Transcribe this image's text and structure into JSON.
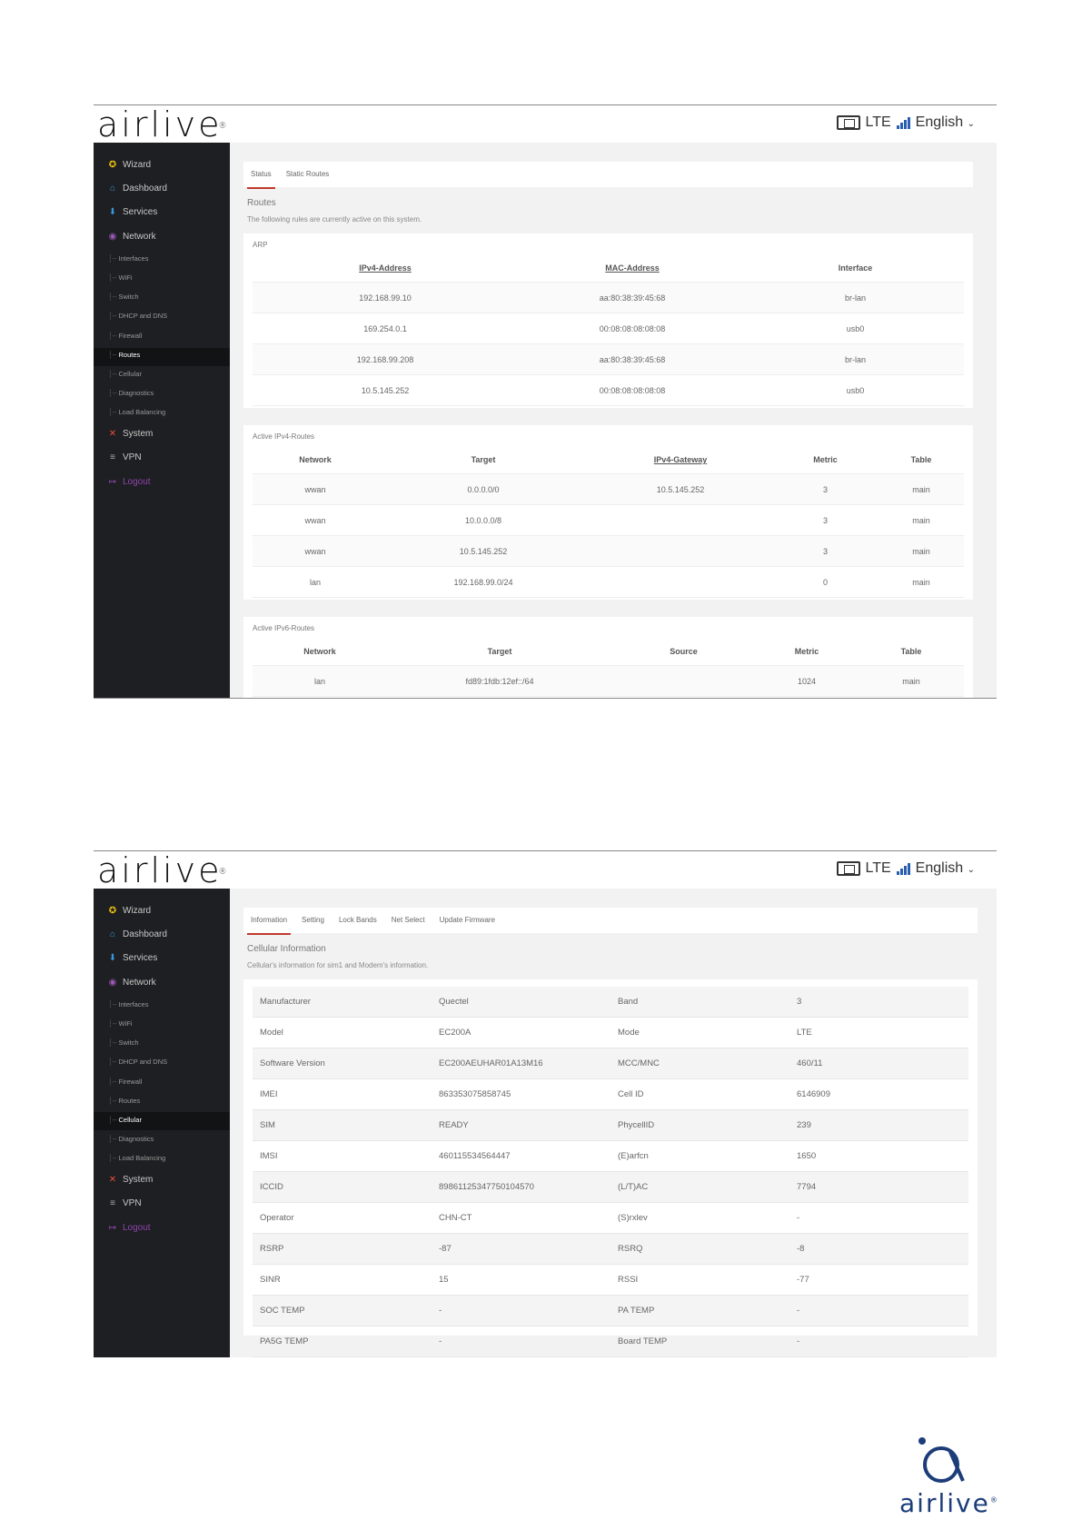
{
  "brand": {
    "logo": "airlive",
    "registered": "®"
  },
  "header": {
    "network": "LTE",
    "language": "English",
    "caret": "⌄"
  },
  "sidebar": {
    "wizard": "Wizard",
    "dashboard": "Dashboard",
    "services": "Services",
    "network": "Network",
    "sub": [
      "Interfaces",
      "WiFi",
      "Switch",
      "DHCP and DNS",
      "Firewall",
      "Routes",
      "Cellular",
      "Diagnostics",
      "Load Balancing"
    ],
    "system": "System",
    "vpn": "VPN",
    "logout": "Logout"
  },
  "routes": {
    "tabs": [
      "Status",
      "Static Routes"
    ],
    "title": "Routes",
    "description": "The following rules are currently active on this system.",
    "arp": {
      "title": "ARP",
      "headers": [
        "IPv4-Address",
        "MAC-Address",
        "Interface"
      ],
      "rows": [
        [
          "192.168.99.10",
          "aa:80:38:39:45:68",
          "br-lan"
        ],
        [
          "169.254.0.1",
          "00:08:08:08:08:08",
          "usb0"
        ],
        [
          "192.168.99.208",
          "aa:80:38:39:45:68",
          "br-lan"
        ],
        [
          "10.5.145.252",
          "00:08:08:08:08:08",
          "usb0"
        ]
      ]
    },
    "ipv4": {
      "title": "Active IPv4-Routes",
      "headers": [
        "Network",
        "Target",
        "IPv4-Gateway",
        "Metric",
        "Table"
      ],
      "rows": [
        [
          "wwan",
          "0.0.0.0/0",
          "10.5.145.252",
          "3",
          "main"
        ],
        [
          "wwan",
          "10.0.0.0/8",
          "",
          "3",
          "main"
        ],
        [
          "wwan",
          "10.5.145.252",
          "",
          "3",
          "main"
        ],
        [
          "lan",
          "192.168.99.0/24",
          "",
          "0",
          "main"
        ]
      ]
    },
    "ipv6": {
      "title": "Active IPv6-Routes",
      "headers": [
        "Network",
        "Target",
        "Source",
        "Metric",
        "Table"
      ],
      "rows": [
        [
          "lan",
          "fd89:1fdb:12ef::/64",
          "",
          "1024",
          "main"
        ]
      ]
    }
  },
  "cellular": {
    "tabs": [
      "Information",
      "Setting",
      "Lock Bands",
      "Net Select",
      "Update Firmware"
    ],
    "title": "Cellular Information",
    "description": "Cellular's information for sim1 and Modem's information.",
    "rows": [
      [
        "Manufacturer",
        "Quectel",
        "Band",
        "3"
      ],
      [
        "Model",
        "EC200A",
        "Mode",
        "LTE"
      ],
      [
        "Software Version",
        "EC200AEUHAR01A13M16",
        "MCC/MNC",
        "460/11"
      ],
      [
        "IMEI",
        "863353075858745",
        "Cell ID",
        "6146909"
      ],
      [
        "SIM",
        "READY",
        "PhycellID",
        "239"
      ],
      [
        "IMSI",
        "460115534564447",
        "(E)arfcn",
        "1650"
      ],
      [
        "ICCID",
        "89861125347750104570",
        "(L/T)AC",
        "7794"
      ],
      [
        "Operator",
        "CHN-CT",
        "(S)rxlev",
        "-"
      ],
      [
        "RSRP",
        "-87",
        "RSRQ",
        "-8"
      ],
      [
        "SINR",
        "15",
        "RSSI",
        "-77"
      ],
      [
        "SOC TEMP",
        "-",
        "PA TEMP",
        "-"
      ],
      [
        "PA5G TEMP",
        "-",
        "Board TEMP",
        "-"
      ]
    ]
  },
  "colors": {
    "sidebar": "#1e1f22",
    "accent": "#c0392b",
    "brand_blue": "#1d3d7a",
    "logout": "#8e44ad"
  },
  "icons": [
    "wizard-icon",
    "dashboard-icon",
    "services-icon",
    "network-icon",
    "system-icon",
    "vpn-icon",
    "logout-icon",
    "sim-icon",
    "signal-icon"
  ]
}
